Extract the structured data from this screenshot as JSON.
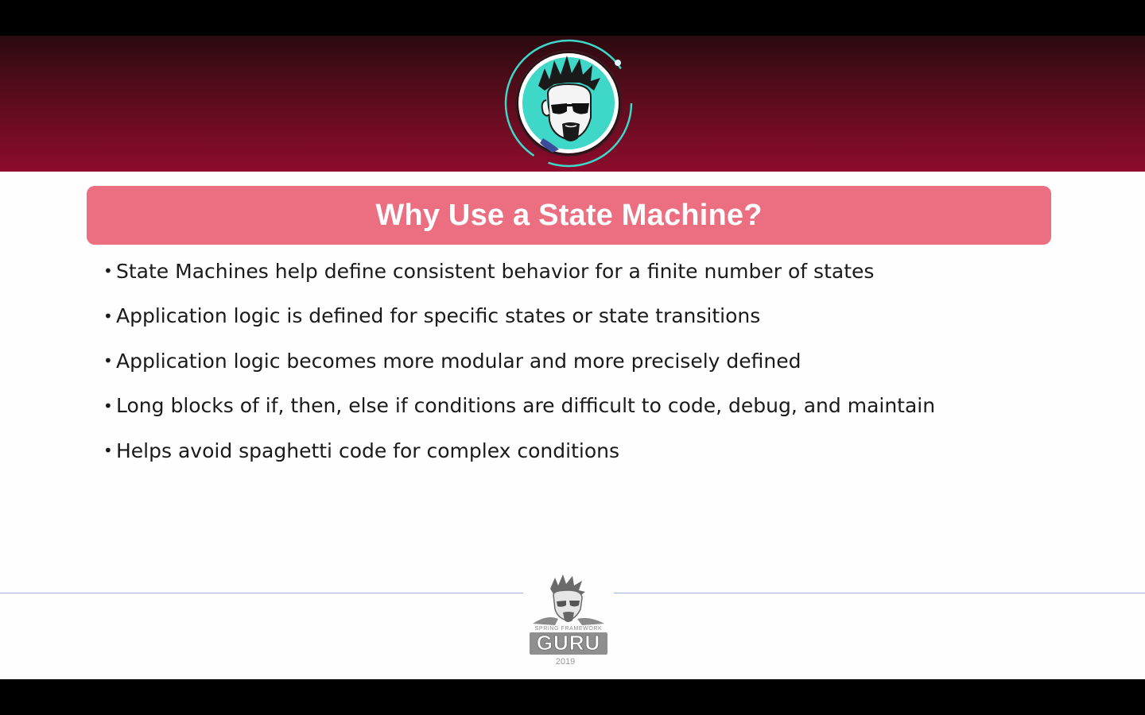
{
  "slide": {
    "title": "Why Use a State Machine?",
    "bullets": [
      "State Machines help define consistent behavior for a finite number of states",
      "Application logic is defined for specific states or state transitions",
      "Application logic becomes more modular and more precisely defined",
      "Long blocks of if, then, else if conditions are difficult to code, debug, and maintain",
      "Helps avoid spaghetti code for complex conditions"
    ],
    "bullet_marker": "•"
  },
  "footer": {
    "logo_caption": "SPRING FRAMEWORK",
    "logo_word": "GURU",
    "year": "2019"
  },
  "colors": {
    "header_dark": "#2a0a10",
    "header_red": "#8d0b2c",
    "title_bar": "#eb6f80",
    "avatar_teal": "#3fd7c7",
    "footer_line": "#9cb0d8"
  },
  "icons": {
    "header_avatar": "guru-avatar-icon",
    "footer_logo": "spring-framework-guru-logo"
  }
}
